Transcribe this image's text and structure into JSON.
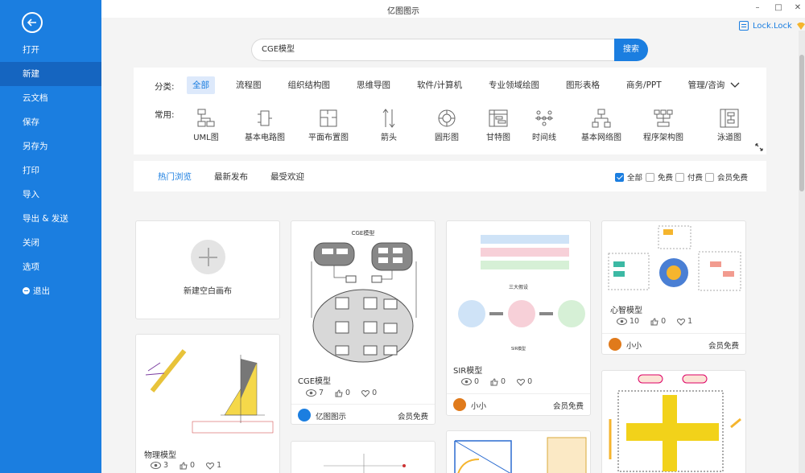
{
  "window": {
    "title": "亿图图示",
    "minimize": "–",
    "maximize": "□",
    "close": "✕",
    "user": "Lock.Lock"
  },
  "sidebar": {
    "items": [
      {
        "label": "打开"
      },
      {
        "label": "新建"
      },
      {
        "label": "云文档"
      },
      {
        "label": "保存"
      },
      {
        "label": "另存为"
      },
      {
        "label": "打印"
      },
      {
        "label": "导入"
      },
      {
        "label": "导出 & 发送"
      },
      {
        "label": "关闭"
      },
      {
        "label": "选项"
      },
      {
        "label": "退出"
      }
    ],
    "active_index": 1
  },
  "search": {
    "value": "CGE模型",
    "button": "搜索"
  },
  "categories": {
    "label": "分类:",
    "items": [
      "全部",
      "流程图",
      "组织结构图",
      "思维导图",
      "软件/计算机",
      "专业领域绘图",
      "图形表格",
      "商务/PPT",
      "管理/咨询"
    ],
    "active_index": 0
  },
  "common": {
    "label": "常用:",
    "items": [
      {
        "label": "UML图",
        "icon": "uml-icon"
      },
      {
        "label": "基本电路图",
        "icon": "circuit-icon"
      },
      {
        "label": "平面布置图",
        "icon": "floorplan-icon"
      },
      {
        "label": "箭头",
        "icon": "arrows-icon"
      },
      {
        "label": "圆形图",
        "icon": "circle-diagram-icon"
      },
      {
        "label": "甘特图",
        "icon": "gantt-icon"
      },
      {
        "label": "时间线",
        "icon": "timeline-icon"
      },
      {
        "label": "基本网络图",
        "icon": "network-icon"
      },
      {
        "label": "程序架构图",
        "icon": "architecture-icon"
      },
      {
        "label": "泳道图",
        "icon": "swimlane-icon"
      }
    ]
  },
  "filter": {
    "tabs": [
      "热门浏览",
      "最新发布",
      "最受欢迎"
    ],
    "active_tab": 0,
    "options": [
      {
        "label": "全部",
        "checked": true
      },
      {
        "label": "免费",
        "checked": false
      },
      {
        "label": "付费",
        "checked": false
      },
      {
        "label": "会员免费",
        "checked": false
      }
    ]
  },
  "new_canvas": {
    "label": "新建空白画布"
  },
  "cards": [
    {
      "title": "CGE模型",
      "views": "7",
      "likes": "0",
      "favs": "0",
      "author": "亿图图示",
      "badge": "会员免费",
      "thumb_title": "CGE模型"
    },
    {
      "title": "SIR模型",
      "views": "0",
      "likes": "0",
      "favs": "0",
      "author": "小小",
      "badge": "会员免费",
      "thumb_title": "三大假设",
      "thumb_sub": "SIR模型"
    },
    {
      "title": "心智模型",
      "views": "10",
      "likes": "0",
      "favs": "1",
      "author": "小小",
      "badge": "会员免费"
    },
    {
      "title": "物理模型",
      "views": "3",
      "likes": "0",
      "favs": "1"
    }
  ],
  "colors": {
    "accent": "#1b7ee0",
    "sidebar_active": "#1565c0"
  }
}
